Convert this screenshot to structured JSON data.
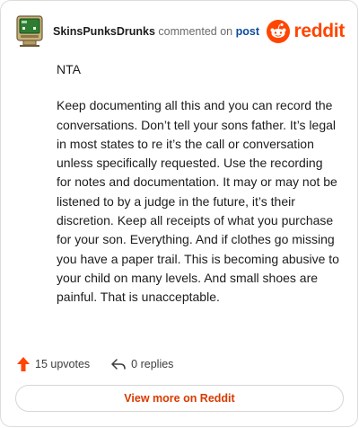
{
  "header": {
    "author": "SkinsPunksDrunks",
    "action": "commented on",
    "link": "post",
    "brand": "reddit",
    "avatar_icon": "retro-computer-avatar-icon",
    "brand_icon": "reddit-snoo-icon"
  },
  "comment": {
    "paragraphs": [
      "NTA",
      "Keep documenting all this and you can record the conversations. Don’t tell your sons father. It’s legal in most states to re it’s the call or conversation unless specifically requested. Use the recording for notes and documentation. It may or may not be listened to by a judge in the future, it’s their discretion. Keep all receipts of what you purchase for your son. Everything. And if clothes go missing you have a paper trail. This is becoming abusive to your child on many levels. And small shoes are painful. That is unacceptable."
    ]
  },
  "footer": {
    "upvotes": "15 upvotes",
    "replies": "0 replies",
    "upvote_icon": "upvote-arrow-icon",
    "reply_icon": "reply-arrow-icon"
  },
  "cta": {
    "label": "View more on Reddit"
  },
  "colors": {
    "brand": "#ff4500",
    "cta": "#d93a00",
    "link": "#0e4c9c"
  }
}
